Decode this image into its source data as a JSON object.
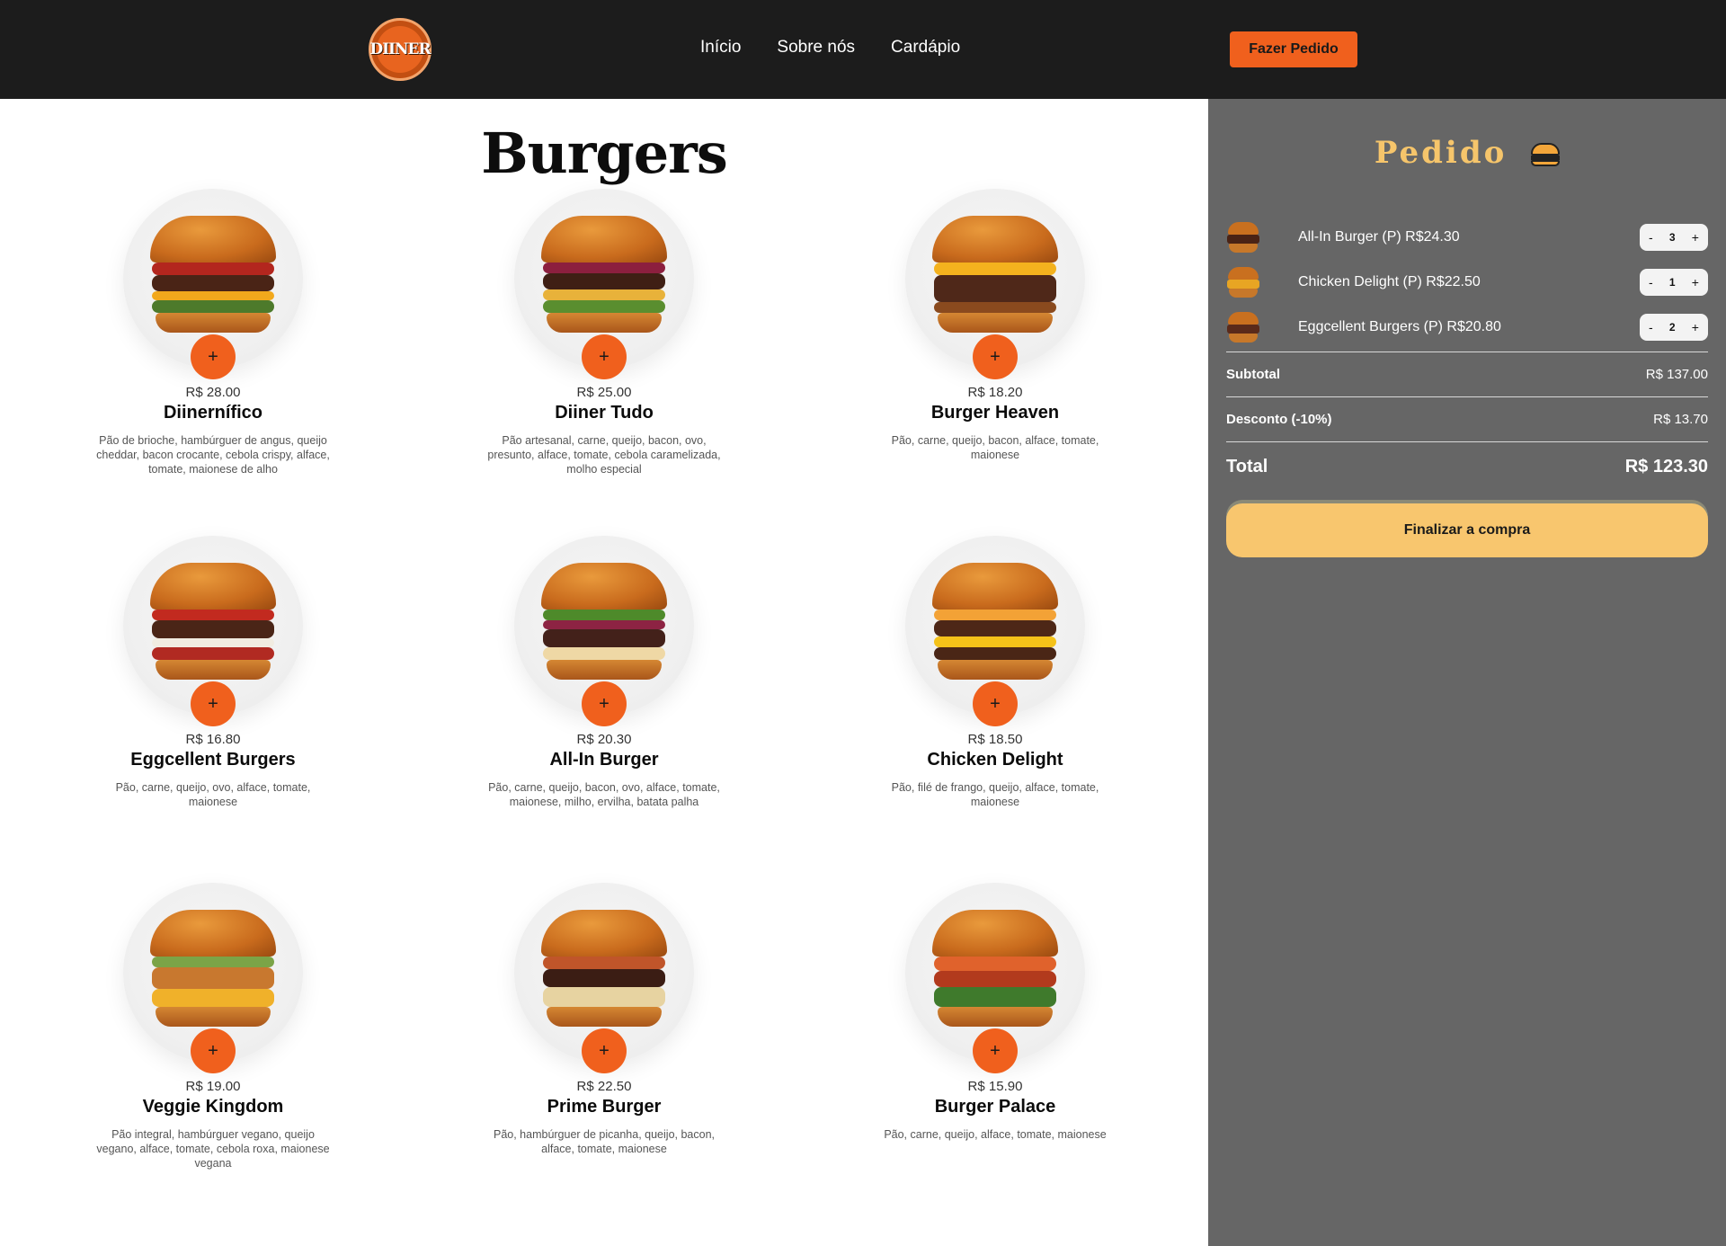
{
  "header": {
    "logo_text": "DIINER",
    "nav": [
      "Início",
      "Sobre nós",
      "Cardápio"
    ],
    "order_button": "Fazer Pedido",
    "colors": {
      "background": "#1c1c1c",
      "accent": "#f0601d"
    }
  },
  "menu": {
    "title": "Burgers",
    "items": [
      {
        "price": "R$ 28.00",
        "name": "Diinernífico",
        "desc": "Pão de brioche, hambúrguer de angus, queijo cheddar, bacon crocante, cebola crispy, alface, tomate, maionese de alho"
      },
      {
        "price": "R$ 25.00",
        "name": "Diiner Tudo",
        "desc": "Pão artesanal, carne, queijo, bacon, ovo, presunto, alface, tomate, cebola caramelizada, molho especial"
      },
      {
        "price": "R$ 18.20",
        "name": "Burger Heaven",
        "desc": "Pão, carne, queijo, bacon, alface, tomate, maionese"
      },
      {
        "price": "R$ 16.80",
        "name": "Eggcellent Burgers",
        "desc": "Pão, carne, queijo, ovo, alface, tomate, maionese"
      },
      {
        "price": "R$ 20.30",
        "name": "All-In Burger",
        "desc": "Pão, carne, queijo, bacon, ovo, alface, tomate, maionese, milho, ervilha, batata palha"
      },
      {
        "price": "R$ 18.50",
        "name": "Chicken Delight",
        "desc": "Pão, filé de frango, queijo, alface, tomate, maionese"
      },
      {
        "price": "R$ 19.00",
        "name": "Veggie Kingdom",
        "desc": "Pão integral, hambúrguer vegano, queijo vegano, alface, tomate, cebola roxa, maionese vegana"
      },
      {
        "price": "R$ 22.50",
        "name": "Prime Burger",
        "desc": "Pão, hambúrguer de picanha, queijo, bacon, alface, tomate, maionese"
      },
      {
        "price": "R$ 15.90",
        "name": "Burger Palace",
        "desc": "Pão, carne, queijo, alface, tomate, maionese"
      }
    ],
    "add_button": "+",
    "icon": "burger-image"
  },
  "order": {
    "title": "Pedido",
    "title_icon": "burger-icon",
    "items": [
      {
        "label": "All-In Burger (P) R$24.30",
        "qty": "3",
        "minus": "-",
        "plus": "+"
      },
      {
        "label": "Chicken Delight (P) R$22.50",
        "qty": "1",
        "minus": "-",
        "plus": "+"
      },
      {
        "label": "Eggcellent Burgers (P) R$20.80",
        "qty": "2",
        "minus": "-",
        "plus": "+"
      }
    ],
    "subtotal_label": "Subtotal",
    "subtotal_value": "R$ 137.00",
    "discount_label": "Desconto (-10%)",
    "discount_value": "R$ 13.70",
    "total_label": "Total",
    "total_value": "R$ 123.30",
    "checkout_button": "Finalizar a compra",
    "colors": {
      "panel": "#666666",
      "title": "#f6c56b",
      "button": "#f8c66e"
    }
  }
}
